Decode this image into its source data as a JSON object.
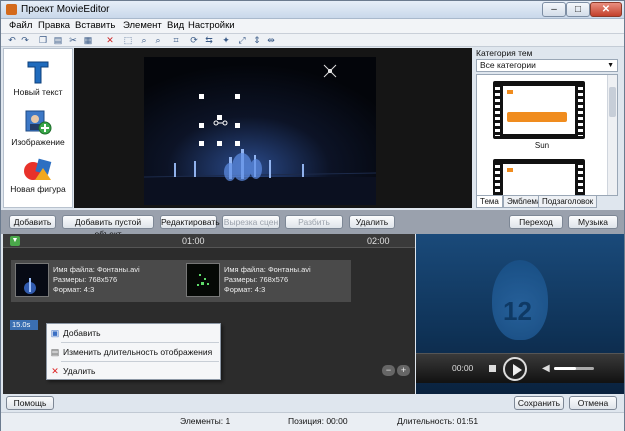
{
  "window": {
    "title": "Проект MovieEditor"
  },
  "menu": [
    "Файл",
    "Правка",
    "Вставить",
    "Элемент",
    "Вид",
    "Настройки"
  ],
  "toolbar": [
    "undo-icon",
    "redo-icon",
    "copy-icon",
    "paste-icon",
    "cut-icon",
    "save-icon",
    "delete-icon",
    "select-icon",
    "zoom-icon",
    "zoom-out-icon",
    "crop-icon",
    "rotate-icon",
    "flip-icon",
    "effects-icon",
    "stretch-icon",
    "align-icon",
    "split-icon"
  ],
  "tools": [
    {
      "label": "Новый текст",
      "icon": "text-icon"
    },
    {
      "label": "Изображение",
      "icon": "image-add-icon"
    },
    {
      "label": "Новая фигура",
      "icon": "shape-icon"
    }
  ],
  "theme_panel": {
    "label": "Категория тем",
    "selected": "Все категории",
    "items": [
      {
        "name": "Sun"
      },
      {
        "name": ""
      }
    ],
    "tabs": [
      "Тема",
      "Эмблема",
      "Подзаголовок"
    ]
  },
  "actions": {
    "add": "Добавить",
    "add_empty": "Добавить пустой объект",
    "edit": "Редактировать",
    "cut_video": "Вырезка сцен",
    "split_video": "Разбить видео",
    "delete": "Удалить",
    "transition": "Переход",
    "music": "Музыка"
  },
  "timeline": {
    "marks": [
      "01:00",
      "02:00"
    ],
    "clips": [
      {
        "name": "Имя файла: Фонтаны.avi",
        "size": "Размеры: 768x576",
        "format": "Формат: 4:3"
      },
      {
        "name": "Имя файла: Фонтаны.avi",
        "size": "Размеры: 768x576",
        "format": "Формат: 4:3"
      }
    ],
    "duration_label": "15.0s"
  },
  "context_menu": {
    "add": "Добавить",
    "change_duration": "Изменить длительность отображения",
    "delete": "Удалить"
  },
  "player": {
    "time": "00:00",
    "logo_number": "12",
    "volume": 0.55
  },
  "footer": {
    "help": "Помощь",
    "save": "Сохранить",
    "cancel": "Отмена"
  },
  "status": {
    "elements": "Элементы: 1",
    "position": "Позиция: 00:00",
    "duration": "Длительность: 01:51"
  }
}
